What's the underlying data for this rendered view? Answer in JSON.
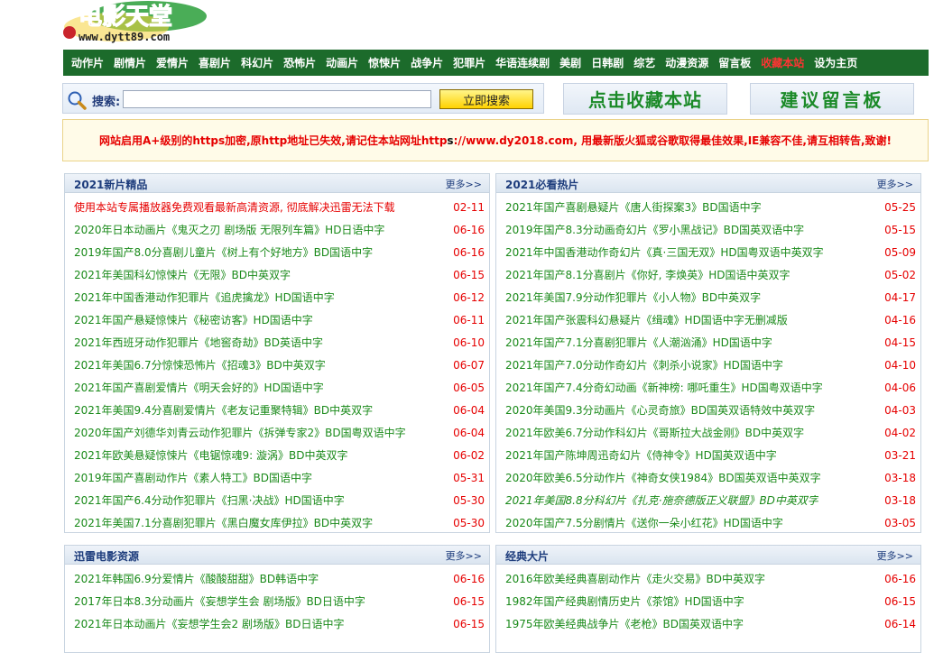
{
  "logo": {
    "title": "电影天堂",
    "url": "www.dytt89.com"
  },
  "nav": [
    {
      "label": "动作片"
    },
    {
      "label": "剧情片"
    },
    {
      "label": "爱情片"
    },
    {
      "label": "喜剧片"
    },
    {
      "label": "科幻片"
    },
    {
      "label": "恐怖片"
    },
    {
      "label": "动画片"
    },
    {
      "label": "惊悚片"
    },
    {
      "label": "战争片"
    },
    {
      "label": "犯罪片"
    },
    {
      "label": "华语连续剧"
    },
    {
      "label": "美剧"
    },
    {
      "label": "日韩剧"
    },
    {
      "label": "综艺"
    },
    {
      "label": "动漫资源"
    },
    {
      "label": "留言板"
    },
    {
      "label": "收藏本站"
    },
    {
      "label": "设为主页"
    }
  ],
  "search": {
    "label": "搜索:",
    "value": "",
    "button": "立即搜索"
  },
  "actions": {
    "bookmark": "点击收藏本站",
    "message": "建议留言板"
  },
  "notice": {
    "part1": "网站启用A+级别的https加密,原http地址已失效,请记住本站网址http",
    "part2": "s",
    "part3": "://www.dy2018.com, 用最新版火狐或谷歌取得最佳效果,IE兼容不佳,请互相转告,致谢!"
  },
  "panels": {
    "p1": {
      "title": "2021新片精品",
      "more": "更多>>",
      "rows": [
        {
          "title": "使用本站专属播放器免费观看最新高清资源, 彻底解决迅雷无法下载",
          "date": "02-11"
        },
        {
          "title": "2020年日本动画片《鬼灭之刃 剧场版 无限列车篇》HD日语中字",
          "date": "06-16"
        },
        {
          "title": "2019年国产8.0分喜剧儿童片《树上有个好地方》BD国语中字",
          "date": "06-16"
        },
        {
          "title": "2021年美国科幻惊悚片《无限》BD中英双字",
          "date": "06-15"
        },
        {
          "title": "2021年中国香港动作犯罪片《追虎擒龙》HD国语中字",
          "date": "06-12"
        },
        {
          "title": "2021年国产悬疑惊悚片《秘密访客》HD国语中字",
          "date": "06-11"
        },
        {
          "title": "2021年西班牙动作犯罪片《地窖奇劫》BD英语中字",
          "date": "06-10"
        },
        {
          "title": "2021年美国6.7分惊悚恐怖片《招魂3》BD中英双字",
          "date": "06-07"
        },
        {
          "title": "2021年国产喜剧爱情片《明天会好的》HD国语中字",
          "date": "06-05"
        },
        {
          "title": "2021年美国9.4分喜剧爱情片《老友记重聚特辑》BD中英双字",
          "date": "06-04"
        },
        {
          "title": "2020年国产刘德华刘青云动作犯罪片《拆弹专家2》BD国粤双语中字",
          "date": "06-04"
        },
        {
          "title": "2021年欧美悬疑惊悚片《电锯惊魂9: 漩涡》BD中英双字",
          "date": "06-02"
        },
        {
          "title": "2019年国产喜剧动作片《素人特工》BD国语中字",
          "date": "05-31"
        },
        {
          "title": "2021年国产6.4分动作犯罪片《扫黑·决战》HD国语中字",
          "date": "05-30"
        },
        {
          "title": "2021年美国7.1分喜剧犯罪片《黑白魔女库伊拉》BD中英双字",
          "date": "05-30"
        }
      ]
    },
    "p2": {
      "title": "2021必看热片",
      "more": "更多>>",
      "rows": [
        {
          "title": "2021年国产喜剧悬疑片《唐人街探案3》BD国语中字",
          "date": "05-25"
        },
        {
          "title": "2019年国产8.3分动画奇幻片《罗小黑战记》BD国英双语中字",
          "date": "05-15"
        },
        {
          "title": "2021年中国香港动作奇幻片《真·三国无双》HD国粤双语中英双字",
          "date": "05-09"
        },
        {
          "title": "2021年国产8.1分喜剧片《你好, 李焕英》HD国语中英双字",
          "date": "05-02"
        },
        {
          "title": "2021年美国7.9分动作犯罪片《小人物》BD中英双字",
          "date": "04-17"
        },
        {
          "title": "2021年国产张震科幻悬疑片《缉魂》HD国语中字无删减版",
          "date": "04-16"
        },
        {
          "title": "2021年国产7.1分喜剧犯罪片《人潮汹涌》HD国语中字",
          "date": "04-15"
        },
        {
          "title": "2021年国产7.0分动作奇幻片《刺杀小说家》HD国语中字",
          "date": "04-10"
        },
        {
          "title": "2021年国产7.4分奇幻动画《新神榜: 哪吒重生》HD国粤双语中字",
          "date": "04-06"
        },
        {
          "title": "2020年美国9.3分动画片《心灵奇旅》BD国英双语特效中英双字",
          "date": "04-03"
        },
        {
          "title": "2021年欧美6.7分动作科幻片《哥斯拉大战金刚》BD中英双字",
          "date": "04-02"
        },
        {
          "title": "2021年国产陈坤周迅奇幻片《侍神令》HD国英双语中字",
          "date": "03-21"
        },
        {
          "title": "2020年欧美6.5分动作片《神奇女侠1984》BD国英双语中英双字",
          "date": "03-18"
        },
        {
          "title": "2021年美国8.8分科幻片《扎克·施奈德版正义联盟》BD中英双字",
          "date": "03-18"
        },
        {
          "title": "2020年国产7.5分剧情片《送你一朵小红花》HD国语中字",
          "date": "03-05"
        }
      ]
    },
    "p3": {
      "title": "迅雷电影资源",
      "more": "更多>>",
      "rows": [
        {
          "title": "2021年韩国6.9分爱情片《酸酸甜甜》BD韩语中字",
          "date": "06-16"
        },
        {
          "title": "2017年日本8.3分动画片《妄想学生会 剧场版》BD日语中字",
          "date": "06-15"
        },
        {
          "title": "2021年日本动画片《妄想学生会2 剧场版》BD日语中字",
          "date": "06-15"
        }
      ]
    },
    "p4": {
      "title": "经典大片",
      "more": "更多>>",
      "rows": [
        {
          "title": "2016年欧美经典喜剧动作片《走火交易》BD中英双字",
          "date": "06-16"
        },
        {
          "title": "1982年国产经典剧情历史片《茶馆》HD国语中字",
          "date": "06-15"
        },
        {
          "title": "1975年欧美经典战争片《老枪》BD国英双语中字",
          "date": "06-14"
        }
      ]
    }
  }
}
